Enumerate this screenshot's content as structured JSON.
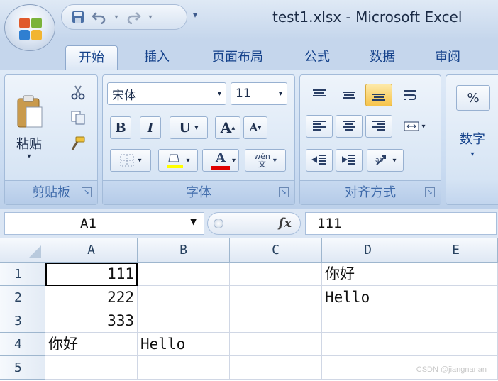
{
  "window": {
    "title": "test1.xlsx - Microsoft Excel"
  },
  "quick_access": {
    "customize_glyph": "▾"
  },
  "tabs": [
    "开始",
    "插入",
    "页面布局",
    "公式",
    "数据",
    "审阅"
  ],
  "ribbon": {
    "clipboard": {
      "label": "剪贴板",
      "paste_label": "粘贴"
    },
    "font": {
      "label": "字体",
      "name": "宋体",
      "size": "11",
      "bold": "B",
      "italic": "I",
      "underline": "U",
      "grow": "A",
      "shrink": "A",
      "font_color_glyph": "A",
      "phonetic": "wén\n文"
    },
    "alignment": {
      "label": "对齐方式"
    },
    "number": {
      "label": "数字",
      "percent": "%"
    }
  },
  "formula_bar": {
    "name_box": "A1",
    "fx": "fx",
    "formula": "111"
  },
  "sheet": {
    "columns": [
      "A",
      "B",
      "C",
      "D",
      "E"
    ],
    "rows": [
      "1",
      "2",
      "3",
      "4",
      "5"
    ],
    "cells": {
      "A1": "111",
      "A2": "222",
      "A3": "333",
      "A4": "你好",
      "B4": "Hello",
      "D1": "你好",
      "D2": "Hello"
    }
  },
  "watermark": "CSDN @jiangnanan",
  "colors": {
    "accent": "#15428b",
    "ribbon": "#c9dbf1",
    "grid_line": "#d0d7e5"
  }
}
